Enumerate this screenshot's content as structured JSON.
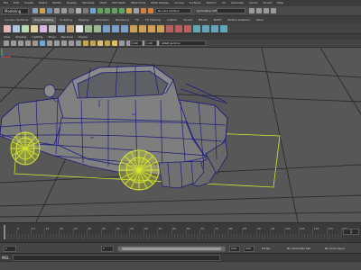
{
  "menubar": [
    "File",
    "Edit",
    "Create",
    "Select",
    "Modify",
    "Display",
    "Windows",
    "Mesh",
    "Edit Mesh",
    "Mesh Tools",
    "Mesh Display",
    "Curves",
    "Surfaces",
    "Deform",
    "UV",
    "Generate",
    "Cache",
    "Arnold",
    "Help"
  ],
  "statusline": {
    "mode": "Modeling",
    "no_live_surface": "No Live Surface",
    "symmetry": "Symmetry: Off",
    "search_placeholder": "",
    "workspace": ""
  },
  "shelf_tabs": [
    "Curves / Surfaces",
    "Poly Modeling",
    "Sculpting",
    "Rigging",
    "Animation",
    "Rendering",
    "FX",
    "FX Caching",
    "Custom",
    "Arnold",
    "Bifrost",
    "MASH",
    "Motion Graphics",
    "XGen"
  ],
  "shelf_active_tab": "Poly Modeling",
  "panel_menu": [
    "View",
    "Shading",
    "Lighting",
    "Show",
    "Renderer",
    "Panels"
  ],
  "panel_toolbar": {
    "value_a": "0.00",
    "value_b": "1.00",
    "color_space": "sRGB gamma"
  },
  "viewport": {
    "camera_label": "persp",
    "background": "#575757",
    "grid_color": "#1f1f1f",
    "wire_color": "#1c1c7a",
    "selection_color": "#d8e832"
  },
  "timeslider": {
    "start": "1",
    "current_frame": "1",
    "ticks": [
      "5",
      "10",
      "15",
      "20",
      "25",
      "30",
      "35",
      "40",
      "45",
      "50",
      "55",
      "60",
      "65",
      "70",
      "75",
      "80",
      "85",
      "90",
      "95",
      "100",
      "105",
      "110",
      "115",
      "120"
    ]
  },
  "rangeslider": {
    "start": "1",
    "playback_start": "1",
    "playback_end": "120",
    "end": "200",
    "character_set": "No Character Set",
    "anim_layer": "No Anim Layer",
    "fps": "24 fps"
  },
  "cmdline": {
    "language": "MEL"
  },
  "helpline": {
    "text": ""
  }
}
